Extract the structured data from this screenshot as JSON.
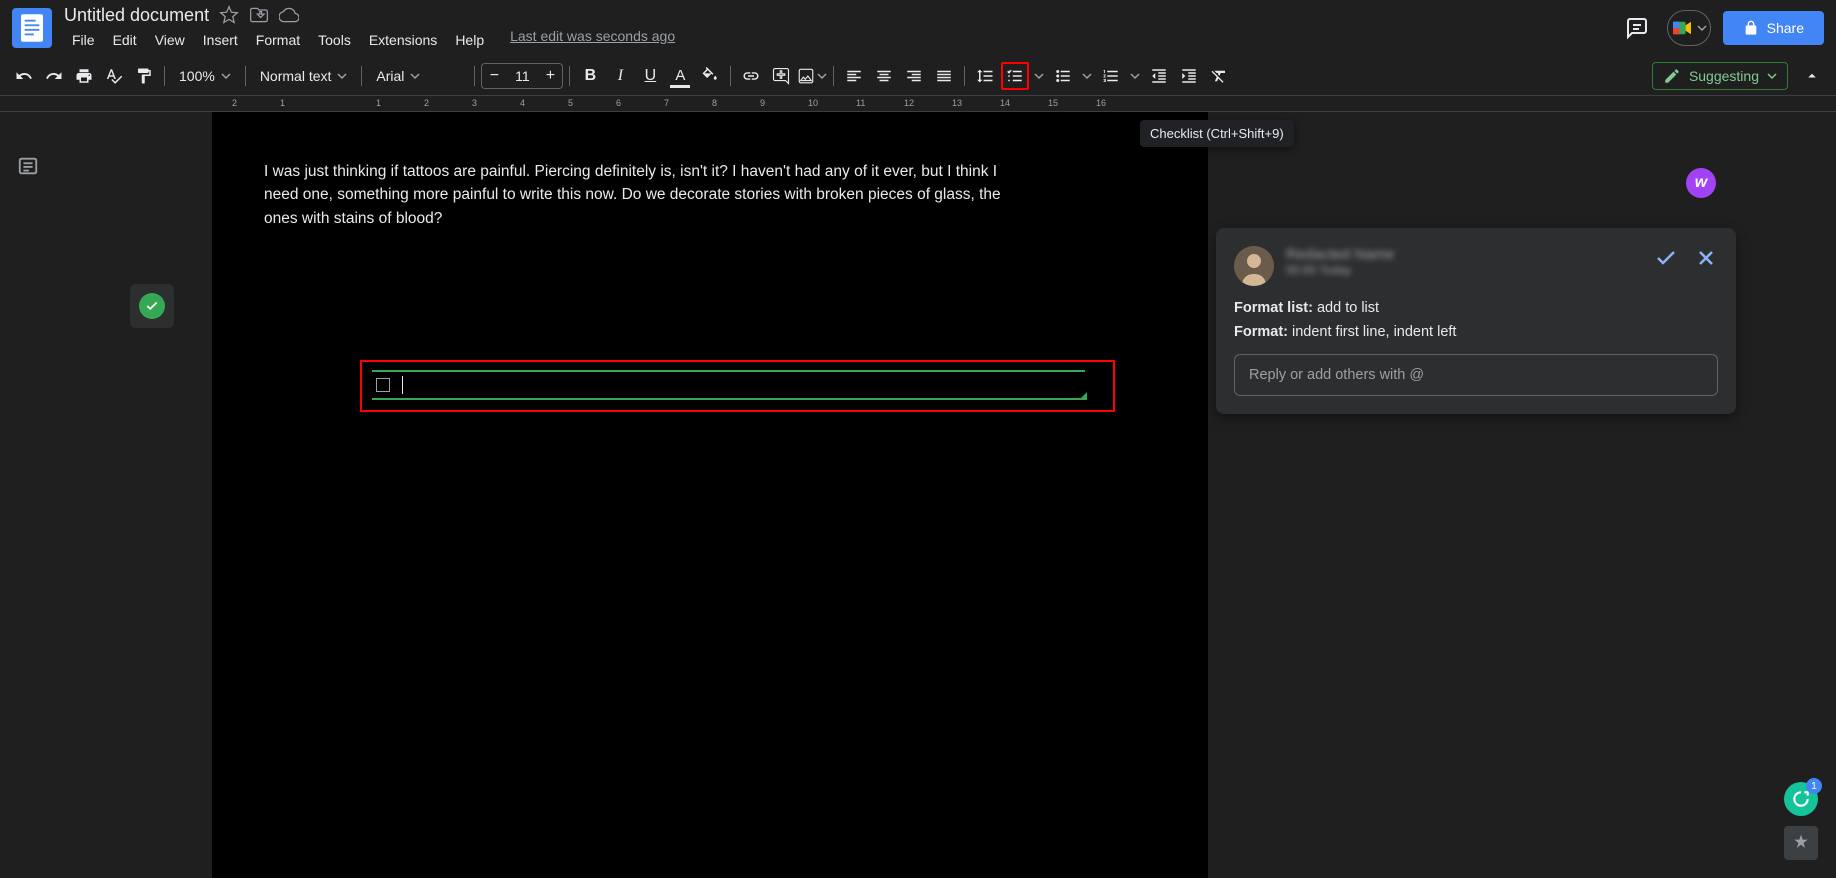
{
  "header": {
    "title": "Untitled document",
    "last_edit": "Last edit was seconds ago",
    "share_label": "Share"
  },
  "menubar": [
    "File",
    "Edit",
    "View",
    "Insert",
    "Format",
    "Tools",
    "Extensions",
    "Help"
  ],
  "toolbar": {
    "zoom": "100%",
    "style": "Normal text",
    "font": "Arial",
    "font_size": "11",
    "suggesting_label": "Suggesting"
  },
  "tooltip": "Checklist (Ctrl+Shift+9)",
  "ruler": [
    "2",
    "1",
    "1",
    "2",
    "3",
    "4",
    "5",
    "6",
    "7",
    "8",
    "9",
    "10",
    "11",
    "12",
    "13",
    "14",
    "15",
    "16"
  ],
  "document": {
    "body": "I was just thinking if tattoos are painful. Piercing definitely is, isn't it? I haven't had any of it ever, but I think I need one, something more painful to write this now. Do we decorate stories with broken pieces of glass, the ones with stains of blood?"
  },
  "suggestion": {
    "user_name": "Redacted Name",
    "user_time": "00:00 Today",
    "line1_label": "Format list:",
    "line1_value": " add to list",
    "line2_label": "Format:",
    "line2_value": " indent first line, indent left",
    "reply_placeholder": "Reply or add others with @"
  },
  "purple_badge": "w"
}
